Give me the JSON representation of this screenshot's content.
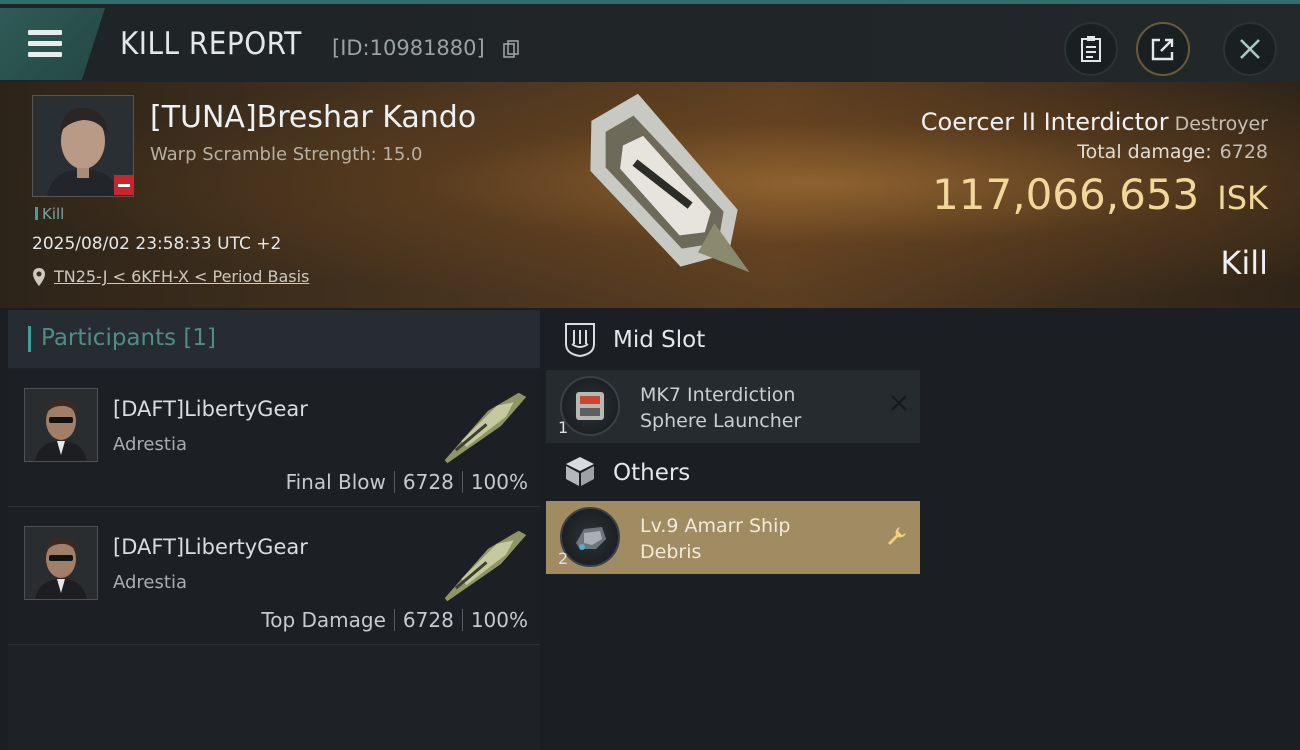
{
  "header": {
    "title": "KILL REPORT",
    "report_id": "[ID:10981880]"
  },
  "victim": {
    "name": "[TUNA]Breshar Kando",
    "warp_scramble": "Warp Scramble Strength: 15.0",
    "tag": "Kill",
    "timestamp": "2025/08/02 23:58:33 UTC +2",
    "location": "TN25-J < 6KFH-X < Period Basis",
    "ship_name": "Coercer II Interdictor",
    "ship_class": "Destroyer",
    "total_damage_label": "Total damage:",
    "total_damage": "6728",
    "isk_value": "117,066,653",
    "isk_unit": "ISK",
    "result": "Kill"
  },
  "participants": {
    "title": "Participants",
    "count": "[1]",
    "rows": [
      {
        "name": "[DAFT]LibertyGear",
        "corp": "Adrestia",
        "role": "Final Blow",
        "damage": "6728",
        "percent": "100%"
      },
      {
        "name": "[DAFT]LibertyGear",
        "corp": "Adrestia",
        "role": "Top Damage",
        "damage": "6728",
        "percent": "100%"
      }
    ]
  },
  "fitting": {
    "mid_slot": {
      "title": "Mid Slot",
      "items": [
        {
          "name_line1": "MK7 Interdiction",
          "name_line2": "Sphere Launcher",
          "qty": "1"
        }
      ]
    },
    "others": {
      "title": "Others",
      "items": [
        {
          "name_line1": "Lv.9 Amarr Ship",
          "name_line2": "Debris",
          "qty": "2"
        }
      ]
    }
  },
  "colors": {
    "accent_teal": "#3ea09a",
    "isk_gold": "#f1d79a",
    "highlight_item": "#a08b62",
    "badge_red": "#c8262a"
  }
}
